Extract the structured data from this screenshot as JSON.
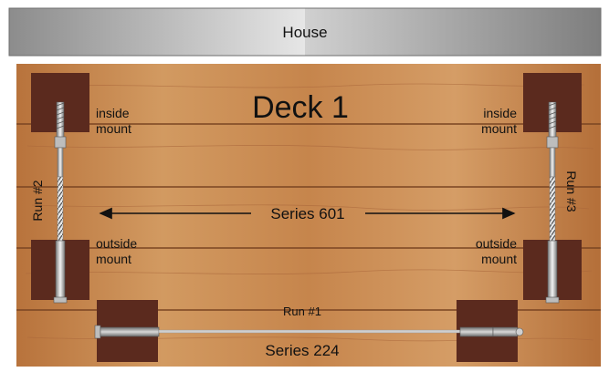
{
  "house": {
    "label": "House"
  },
  "deck": {
    "title": "Deck 1"
  },
  "labels": {
    "inside_mount_left_1": "inside",
    "inside_mount_left_2": "mount",
    "inside_mount_right_1": "inside",
    "inside_mount_right_2": "mount",
    "outside_mount_left_1": "outside",
    "outside_mount_left_2": "mount",
    "outside_mount_right_1": "outside",
    "outside_mount_right_2": "mount",
    "run1": "Run #1",
    "run2": "Run #2",
    "run3": "Run #3",
    "series_601": "Series 601",
    "series_224": "Series 224"
  },
  "colors": {
    "wood": "#c98a52",
    "wood_dark": "#9a5d2e",
    "post": "#5a2a1d",
    "house_light": "#e2e2e2",
    "house_dark": "#8a8a8a",
    "cable": "#c8c8c8"
  }
}
